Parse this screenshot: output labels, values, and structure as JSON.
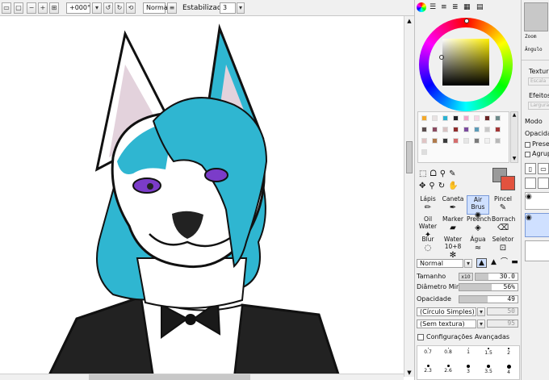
{
  "toolbar": {
    "rotation_value": "+000°",
    "blend_mode": "Normal",
    "stabilizer_label": "Estabilizador",
    "stabilizer_value": "3"
  },
  "navigator": {
    "zoom_label": "Zoom",
    "angle_label": "Ângulo"
  },
  "layer_panel": {
    "texture_label": "Textura",
    "texture_scale": "Escala",
    "effects_label": "Efeitos",
    "effects_width": "Largura",
    "mode_label": "Modo",
    "opacity_label": "Opacidad",
    "preserve_label": "Preser",
    "group_label": "Agrupa"
  },
  "tools": {
    "row1": [
      "Lápis",
      "Caneta",
      "Air Brus",
      "Pincel"
    ],
    "row2": [
      "Oil Water",
      "Marker",
      "Preench",
      "Borrach"
    ],
    "row3": [
      "Blur",
      "Water 10+8",
      "Água",
      "Seletor"
    ],
    "selected": "Air Brus"
  },
  "brush": {
    "blend": "Normal",
    "size_label": "Tamanho",
    "size_multiplier": "x10",
    "size_value": "30.0",
    "min_diameter_label": "Diâmetro Min.",
    "min_diameter_value": "56%",
    "min_diameter_fraction": 0.56,
    "opacity_label": "Opacidade",
    "opacity_value": "49",
    "opacity_fraction": 0.49,
    "shape": "(Círculo Simples)",
    "shape_value": "50",
    "texture": "(Sem textura)",
    "texture_value": "95",
    "advanced_label": "Configurações Avançadas",
    "dot_sizes_row1": [
      "0.7",
      "0.8",
      "1",
      "1.5",
      "2"
    ],
    "dot_sizes_row2": [
      "2.3",
      "2.6",
      "3",
      "3.5",
      "4"
    ]
  },
  "colors": {
    "primary": "#9a9a9a",
    "secondary": "#e2523e",
    "fur_blue": "#2fb6d1",
    "ear_pink": "#e3d2dc",
    "eye_purple": "#7b3cc9"
  },
  "palette": [
    "#f3a92b",
    "#e8e2e2",
    "#2bb2d1",
    "#222226",
    "#f2a2c8",
    "#f6d6e6",
    "#6b2525",
    "#6e8b8b",
    "#5a4e4e",
    "#8a4a60",
    "#d8c2c2",
    "#8e2c2c",
    "#7b4b9e",
    "#5b9bb8",
    "#c8c8c8",
    "#a23636",
    "#e0c4c4",
    "#b07a4c",
    "#3b3b3b",
    "#d46c6c",
    "#e6e6e6",
    "#7a7a7a",
    "#f0f0f0",
    "#b8b8b8",
    "#dedede"
  ]
}
